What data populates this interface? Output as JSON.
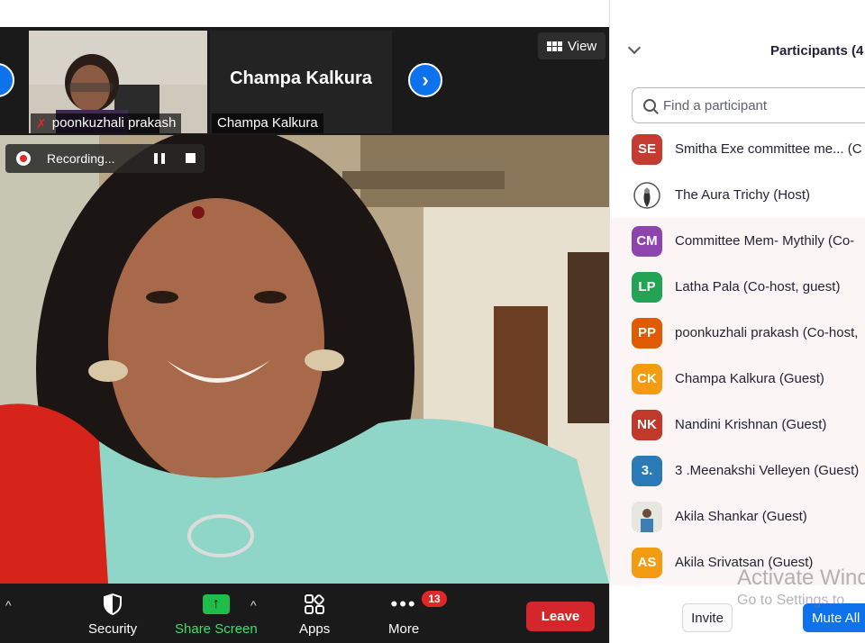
{
  "meeting": {
    "view_label": "View",
    "recording_label": "Recording...",
    "tiles": [
      {
        "name": "poonkuzhali prakash",
        "muted": true
      },
      {
        "name": "Champa Kalkura",
        "big_name": "Champa Kalkura"
      }
    ]
  },
  "toolbar": {
    "security_label": "Security",
    "share_label": "Share Screen",
    "apps_label": "Apps",
    "more_label": "More",
    "more_badge": "13",
    "leave_label": "Leave"
  },
  "panel": {
    "title": "Participants (4",
    "search_placeholder": "Find a participant",
    "participants": [
      {
        "initials": "SE",
        "name": "Smitha Exe committee me...   (C",
        "color": "#c63b2f"
      },
      {
        "initials": "",
        "name": "The Aura Trichy (Host)",
        "color": "#ffffff"
      },
      {
        "initials": "CM",
        "name": "Committee Mem- Mythily (Co-",
        "color": "#8e44ad"
      },
      {
        "initials": "LP",
        "name": "Latha Pala (Co-host, guest)",
        "color": "#23a455"
      },
      {
        "initials": "PP",
        "name": "poonkuzhali prakash (Co-host,",
        "color": "#e05a00"
      },
      {
        "initials": "CK",
        "name": "Champa Kalkura (Guest)",
        "color": "#f39c12"
      },
      {
        "initials": "NK",
        "name": "Nandini Krishnan (Guest)",
        "color": "#c0392b"
      },
      {
        "initials": "3.",
        "name": "3 .Meenakshi Velleyen (Guest)",
        "color": "#2a7ab8"
      },
      {
        "initials": "",
        "name": "Akila Shankar (Guest)",
        "color": "#d9d9d9"
      },
      {
        "initials": "AS",
        "name": "Akila Srivatsan (Guest)",
        "color": "#f39c12"
      }
    ],
    "invite_label": "Invite",
    "mute_all_label": "Mute All"
  },
  "watermark": {
    "line1": "Activate Wind",
    "line2": "Go to Settings to"
  }
}
